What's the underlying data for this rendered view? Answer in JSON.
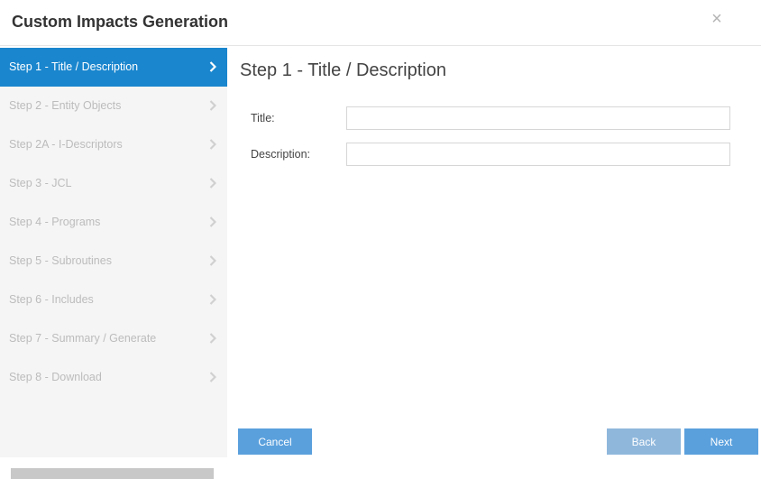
{
  "dialog": {
    "title": "Custom Impacts Generation",
    "close_label": "×"
  },
  "steps": [
    {
      "label": "Step 1 - Title / Description",
      "active": true
    },
    {
      "label": "Step 2 - Entity Objects",
      "active": false
    },
    {
      "label": "Step 2A - I-Descriptors",
      "active": false
    },
    {
      "label": "Step 3 - JCL",
      "active": false
    },
    {
      "label": "Step 4 - Programs",
      "active": false
    },
    {
      "label": "Step 5 - Subroutines",
      "active": false
    },
    {
      "label": "Step 6 - Includes",
      "active": false
    },
    {
      "label": "Step 7 - Summary / Generate",
      "active": false
    },
    {
      "label": "Step 8 - Download",
      "active": false
    }
  ],
  "content": {
    "title": "Step 1 - Title / Description",
    "fields": {
      "title": {
        "label": "Title:",
        "value": ""
      },
      "description": {
        "label": "Description:",
        "value": ""
      }
    }
  },
  "buttons": {
    "cancel": "Cancel",
    "back": "Back",
    "next": "Next"
  },
  "colors": {
    "active_step": "#1a86ce",
    "button": "#5aa0dd",
    "button_disabled": "#8fb7dc"
  }
}
